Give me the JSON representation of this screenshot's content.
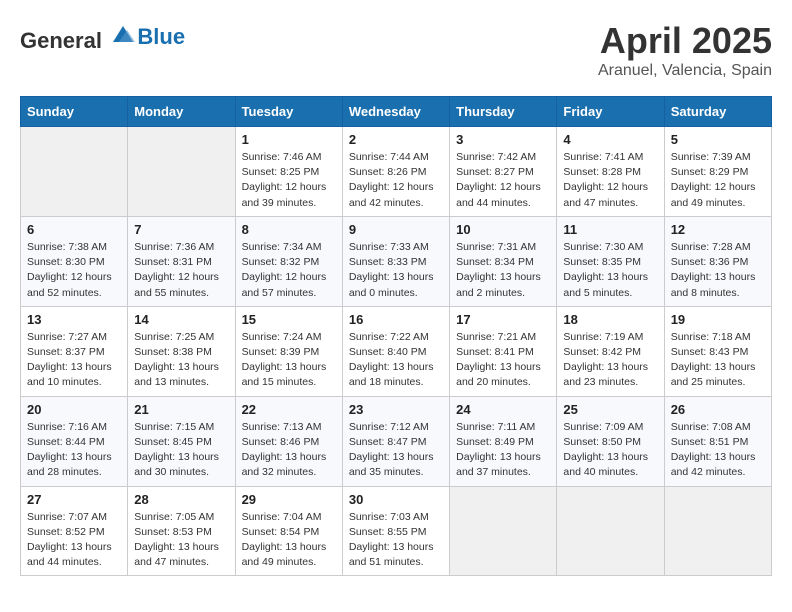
{
  "header": {
    "logo_general": "General",
    "logo_blue": "Blue",
    "month": "April 2025",
    "location": "Aranuel, Valencia, Spain"
  },
  "days_of_week": [
    "Sunday",
    "Monday",
    "Tuesday",
    "Wednesday",
    "Thursday",
    "Friday",
    "Saturday"
  ],
  "weeks": [
    [
      {
        "day": "",
        "info": ""
      },
      {
        "day": "",
        "info": ""
      },
      {
        "day": "1",
        "info": "Sunrise: 7:46 AM\nSunset: 8:25 PM\nDaylight: 12 hours and 39 minutes."
      },
      {
        "day": "2",
        "info": "Sunrise: 7:44 AM\nSunset: 8:26 PM\nDaylight: 12 hours and 42 minutes."
      },
      {
        "day": "3",
        "info": "Sunrise: 7:42 AM\nSunset: 8:27 PM\nDaylight: 12 hours and 44 minutes."
      },
      {
        "day": "4",
        "info": "Sunrise: 7:41 AM\nSunset: 8:28 PM\nDaylight: 12 hours and 47 minutes."
      },
      {
        "day": "5",
        "info": "Sunrise: 7:39 AM\nSunset: 8:29 PM\nDaylight: 12 hours and 49 minutes."
      }
    ],
    [
      {
        "day": "6",
        "info": "Sunrise: 7:38 AM\nSunset: 8:30 PM\nDaylight: 12 hours and 52 minutes."
      },
      {
        "day": "7",
        "info": "Sunrise: 7:36 AM\nSunset: 8:31 PM\nDaylight: 12 hours and 55 minutes."
      },
      {
        "day": "8",
        "info": "Sunrise: 7:34 AM\nSunset: 8:32 PM\nDaylight: 12 hours and 57 minutes."
      },
      {
        "day": "9",
        "info": "Sunrise: 7:33 AM\nSunset: 8:33 PM\nDaylight: 13 hours and 0 minutes."
      },
      {
        "day": "10",
        "info": "Sunrise: 7:31 AM\nSunset: 8:34 PM\nDaylight: 13 hours and 2 minutes."
      },
      {
        "day": "11",
        "info": "Sunrise: 7:30 AM\nSunset: 8:35 PM\nDaylight: 13 hours and 5 minutes."
      },
      {
        "day": "12",
        "info": "Sunrise: 7:28 AM\nSunset: 8:36 PM\nDaylight: 13 hours and 8 minutes."
      }
    ],
    [
      {
        "day": "13",
        "info": "Sunrise: 7:27 AM\nSunset: 8:37 PM\nDaylight: 13 hours and 10 minutes."
      },
      {
        "day": "14",
        "info": "Sunrise: 7:25 AM\nSunset: 8:38 PM\nDaylight: 13 hours and 13 minutes."
      },
      {
        "day": "15",
        "info": "Sunrise: 7:24 AM\nSunset: 8:39 PM\nDaylight: 13 hours and 15 minutes."
      },
      {
        "day": "16",
        "info": "Sunrise: 7:22 AM\nSunset: 8:40 PM\nDaylight: 13 hours and 18 minutes."
      },
      {
        "day": "17",
        "info": "Sunrise: 7:21 AM\nSunset: 8:41 PM\nDaylight: 13 hours and 20 minutes."
      },
      {
        "day": "18",
        "info": "Sunrise: 7:19 AM\nSunset: 8:42 PM\nDaylight: 13 hours and 23 minutes."
      },
      {
        "day": "19",
        "info": "Sunrise: 7:18 AM\nSunset: 8:43 PM\nDaylight: 13 hours and 25 minutes."
      }
    ],
    [
      {
        "day": "20",
        "info": "Sunrise: 7:16 AM\nSunset: 8:44 PM\nDaylight: 13 hours and 28 minutes."
      },
      {
        "day": "21",
        "info": "Sunrise: 7:15 AM\nSunset: 8:45 PM\nDaylight: 13 hours and 30 minutes."
      },
      {
        "day": "22",
        "info": "Sunrise: 7:13 AM\nSunset: 8:46 PM\nDaylight: 13 hours and 32 minutes."
      },
      {
        "day": "23",
        "info": "Sunrise: 7:12 AM\nSunset: 8:47 PM\nDaylight: 13 hours and 35 minutes."
      },
      {
        "day": "24",
        "info": "Sunrise: 7:11 AM\nSunset: 8:49 PM\nDaylight: 13 hours and 37 minutes."
      },
      {
        "day": "25",
        "info": "Sunrise: 7:09 AM\nSunset: 8:50 PM\nDaylight: 13 hours and 40 minutes."
      },
      {
        "day": "26",
        "info": "Sunrise: 7:08 AM\nSunset: 8:51 PM\nDaylight: 13 hours and 42 minutes."
      }
    ],
    [
      {
        "day": "27",
        "info": "Sunrise: 7:07 AM\nSunset: 8:52 PM\nDaylight: 13 hours and 44 minutes."
      },
      {
        "day": "28",
        "info": "Sunrise: 7:05 AM\nSunset: 8:53 PM\nDaylight: 13 hours and 47 minutes."
      },
      {
        "day": "29",
        "info": "Sunrise: 7:04 AM\nSunset: 8:54 PM\nDaylight: 13 hours and 49 minutes."
      },
      {
        "day": "30",
        "info": "Sunrise: 7:03 AM\nSunset: 8:55 PM\nDaylight: 13 hours and 51 minutes."
      },
      {
        "day": "",
        "info": ""
      },
      {
        "day": "",
        "info": ""
      },
      {
        "day": "",
        "info": ""
      }
    ]
  ]
}
